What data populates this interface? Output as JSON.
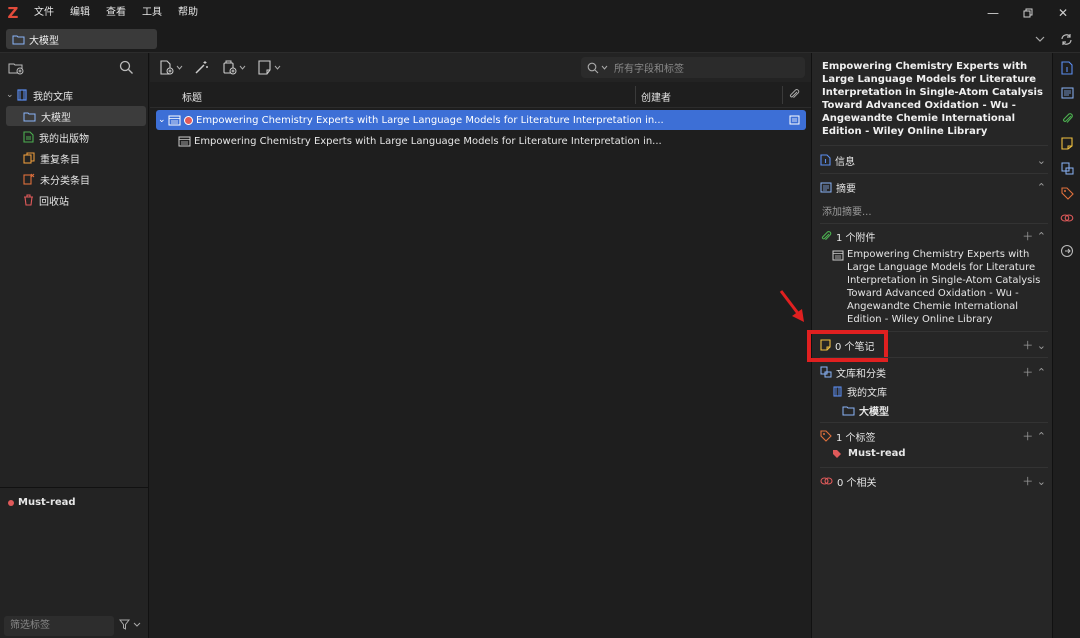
{
  "app": {
    "logo": "Z"
  },
  "menu": [
    "文件",
    "编辑",
    "查看",
    "工具",
    "帮助"
  ],
  "tab": {
    "library_label": "大模型"
  },
  "collections": [
    {
      "label": "我的文库",
      "icon": "library-icon",
      "selected": false
    },
    {
      "label": "大模型",
      "icon": "folder-icon",
      "selected": true
    },
    {
      "label": "我的出版物",
      "icon": "publications-icon",
      "selected": false
    },
    {
      "label": "重复条目",
      "icon": "duplicates-icon",
      "selected": false
    },
    {
      "label": "未分类条目",
      "icon": "unfiled-icon",
      "selected": false
    },
    {
      "label": "回收站",
      "icon": "trash-icon",
      "selected": false
    }
  ],
  "tags_pane": {
    "tag": "Must-read",
    "tag_color": "#e05a5a",
    "filter_placeholder": "筛选标签"
  },
  "search": {
    "placeholder": "所有字段和标签"
  },
  "columns": {
    "title": "标题",
    "creator": "创建者"
  },
  "items": [
    {
      "title": "Empowering Chemistry Experts with Large Language Models for Literature Interpretation in...",
      "selected": true
    },
    {
      "title": "Empowering Chemistry Experts with Large Language Models for Literature Interpretation in...",
      "selected": false
    }
  ],
  "item_pane": {
    "header_title": "Empowering Chemistry Experts with Large Language Models for Literature Interpretation in Single-Atom Catalysis Toward Advanced Oxidation - Wu - Angewandte Chemie International Edition - Wiley Online Library",
    "info_label": "信息",
    "abstract_label": "摘要",
    "abstract_placeholder": "添加摘要...",
    "attachments_label": "1 个附件",
    "attachment_title": "Empowering Chemistry Experts with Large Language Models for Literature Interpretation in Single-Atom Catalysis Toward Advanced Oxidation - Wu - Angewandte Chemie International Edition - Wiley Online Library",
    "notes_label": "0 个笔记",
    "libraries_label": "文库和分类",
    "library_name": "我的文库",
    "collection_name": "大模型",
    "tags_label": "1 个标签",
    "tag_name": "Must-read",
    "related_label": "0 个相关"
  },
  "colors": {
    "accent": "#3d6fd6",
    "highlight": "#e02020",
    "tag": "#e05a5a"
  }
}
